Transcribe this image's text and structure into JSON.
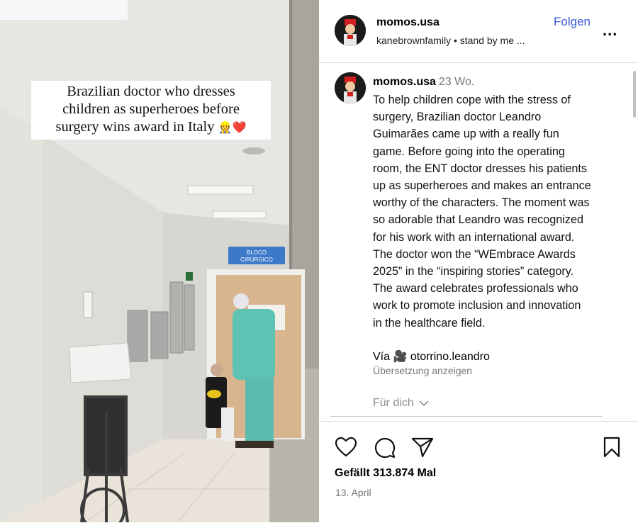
{
  "post": {
    "overlay_caption": {
      "lines": [
        "Brazilian doctor who dresses",
        "children as superheroes before",
        "surgery wins award in Italy"
      ],
      "emojis": "👷❤️"
    },
    "hallway_sign": [
      "BLOCO",
      "CIRÚRGICO"
    ]
  },
  "header": {
    "username": "momos.usa",
    "audio": "kanebrownfamily • stand by me ...",
    "follow_label": "Folgen",
    "more_label": "..."
  },
  "caption": {
    "username": "momos.usa",
    "time": "23 Wo.",
    "lines": [
      "To help children cope with the stress of",
      "surgery, Brazilian doctor Leandro",
      "Guimarães came up with a really fun",
      "game. Before going into the operating",
      "room, the ENT doctor dresses his patients",
      "up as superheroes and makes an entrance",
      "worthy of the characters. The moment was",
      "so adorable that Leandro was recognized",
      "for his work with an international award.",
      "The doctor won the “WEmbrace Awards",
      "2025” in the “inspiring stories” category.",
      "The award celebrates professionals who",
      "work to promote inclusion and innovation",
      "in the healthcare field."
    ],
    "via_prefix": "Vía",
    "via_emoji": "🎥",
    "via_account": "otorrino.leandro",
    "translate_label": "Übersetzung anzeigen",
    "for_you_label": "Für dich"
  },
  "actions": {
    "likes": "Gefällt 313.874 Mal",
    "date": "13. April",
    "icons": [
      "heart-icon",
      "comment-icon",
      "share-icon",
      "bookmark-icon"
    ]
  },
  "colors": {
    "follow": "#3a5ad9",
    "scrub_teal": "#5fc3b4"
  }
}
